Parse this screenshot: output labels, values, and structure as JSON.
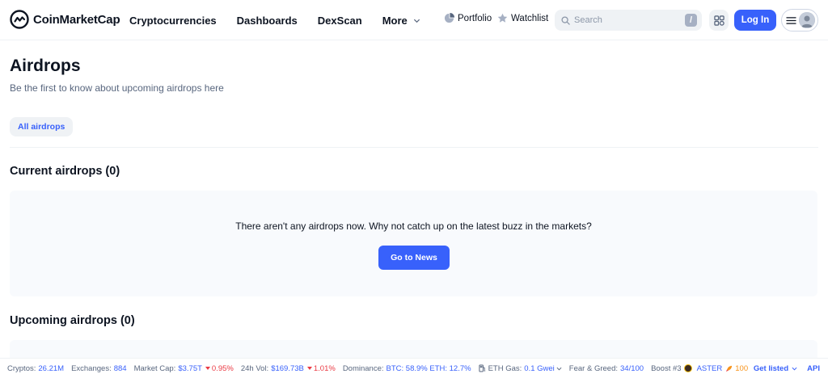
{
  "header": {
    "brand": "CoinMarketCap",
    "nav": [
      {
        "label": "Cryptocurrencies"
      },
      {
        "label": "Dashboards"
      },
      {
        "label": "DexScan"
      },
      {
        "label": "More"
      }
    ],
    "portfolio_label": "Portfolio",
    "watchlist_label": "Watchlist",
    "search_placeholder": "Search",
    "search_shortcut": "/",
    "login_label": "Log In"
  },
  "main": {
    "title": "Airdrops",
    "subtitle": "Be the first to know about upcoming airdrops here",
    "tab_all": "All airdrops",
    "current_title": "Current airdrops (0)",
    "empty_message": "There aren't any airdrops now. Why not catch up on the latest buzz in the markets?",
    "news_button": "Go to News",
    "upcoming_title": "Upcoming airdrops (0)"
  },
  "stats": {
    "cryptos_label": "Cryptos:",
    "cryptos_value": "26.21M",
    "exchanges_label": "Exchanges:",
    "exchanges_value": "884",
    "marketcap_label": "Market Cap:",
    "marketcap_value": "$3.75T",
    "marketcap_change": "0.95%",
    "vol_label": "24h Vol:",
    "vol_value": "$169.73B",
    "vol_change": "1.01%",
    "dominance_label": "Dominance:",
    "dominance_value": "BTC: 58.9% ETH: 12.7%",
    "gas_label": "ETH Gas:",
    "gas_value": "0.1 Gwei",
    "fear_label": "Fear & Greed:",
    "fear_value": "34/100",
    "boost_label": "Boost #3",
    "boost_coin": "ASTER",
    "boost_value": "100",
    "get_listed": "Get listed",
    "api": "API"
  },
  "colors": {
    "accent": "#3861fb",
    "negative": "#ea3943",
    "text": "#0d1421",
    "muted": "#58667e"
  }
}
